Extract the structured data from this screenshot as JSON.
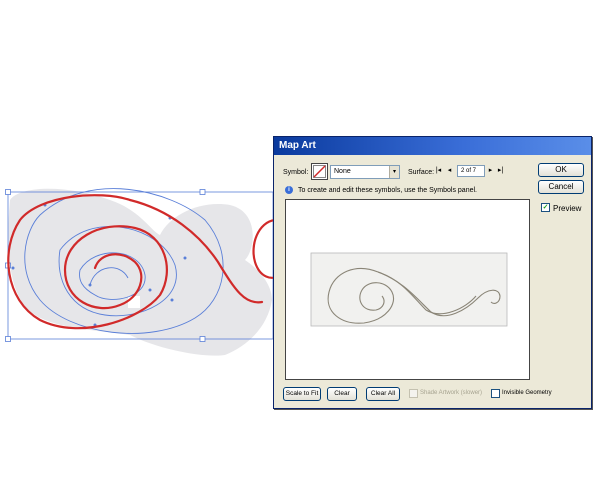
{
  "dialog": {
    "title": "Map Art",
    "symbol_label": "Symbol:",
    "symbol_value": "None",
    "surface_label": "Surface:",
    "surface_page": "2 of 7",
    "info_text": "To create and edit these symbols, use the Symbols panel.",
    "buttons": {
      "ok": "OK",
      "cancel": "Cancel",
      "scale_to_fit": "Scale to Fit",
      "clear": "Clear",
      "clear_all": "Clear All"
    },
    "preview_label": "Preview",
    "preview_checked": true,
    "shade_artwork_label": "Shade Artwork (slower)",
    "shade_artwork_enabled": false,
    "invisible_geometry_label": "Invisible Geometry",
    "invisible_geometry_checked": false
  },
  "icons": {
    "symbol_swatch": "none-swatch-icon",
    "info": "info-icon",
    "first_page": "first-page-icon",
    "prev_page": "prev-page-icon",
    "next_page": "next-page-icon",
    "last_page": "last-page-icon",
    "dropdown": "chevron-down-icon"
  },
  "colors": {
    "spiral_stroke": "#d12a2a",
    "guide_path": "#5a7fd8",
    "surface_fill": "#e6e6e9",
    "dialog_bg": "#ece9d8",
    "titlebar": "#0a3a9e"
  }
}
